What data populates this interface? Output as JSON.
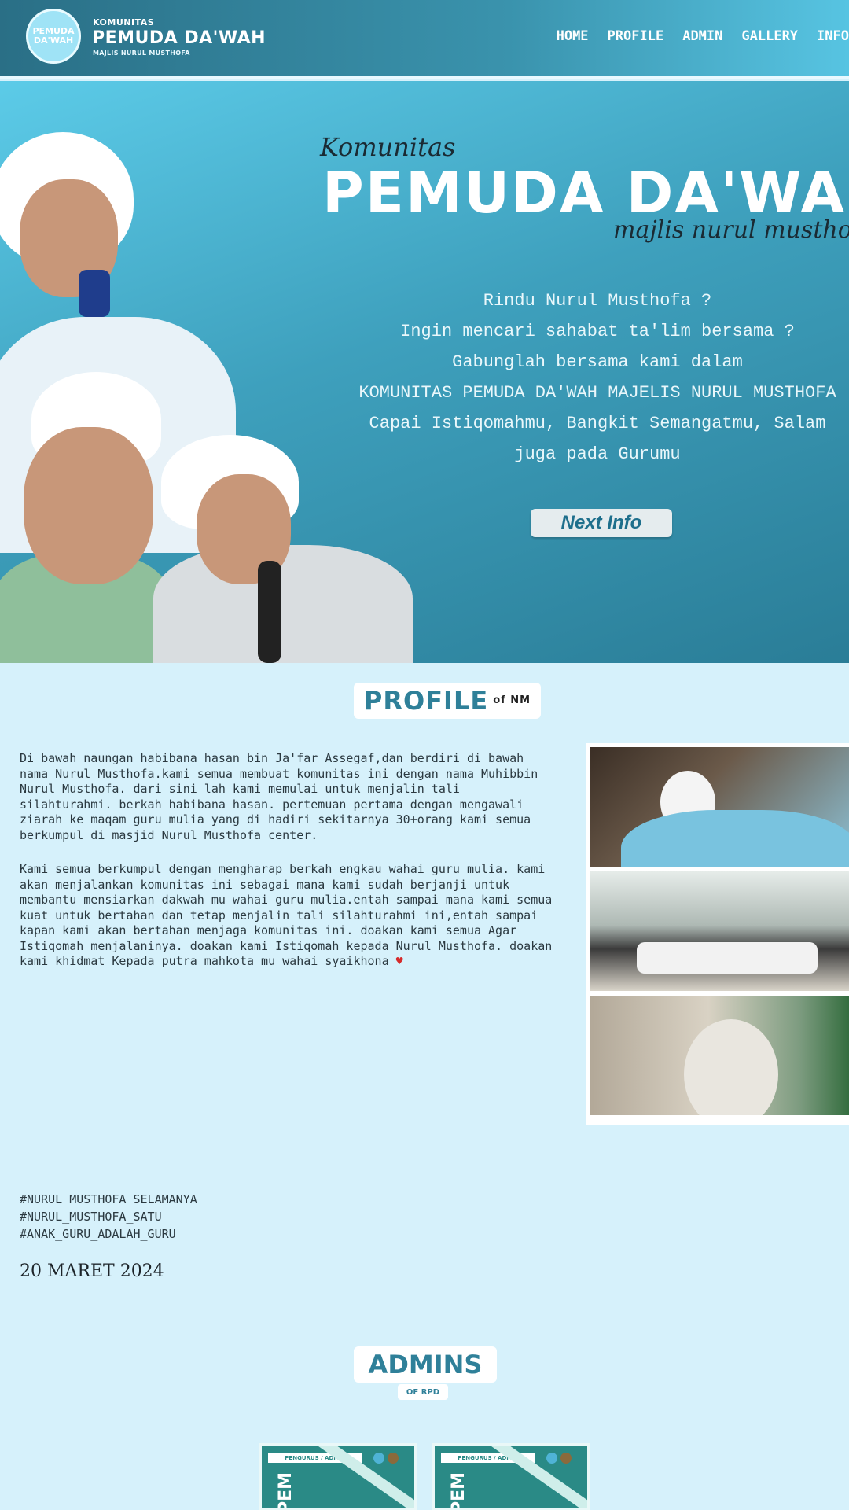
{
  "header": {
    "logo_text": "PEMUDA DA'WAH",
    "brand_small": "KOMUNITAS",
    "brand_title": "PEMUDA DA'WAH",
    "brand_sub": "MAJLIS NURUL MUSTHOFA",
    "nav": [
      "HOME",
      "PROFILE",
      "ADMIN",
      "GALLERY",
      "INFO"
    ]
  },
  "hero": {
    "komunitas": "Komunitas",
    "title": "PEMUDA DA'WAH",
    "majlis": "majlis nurul musthofa",
    "lines": [
      "Rindu Nurul Musthofa ?",
      "Ingin mencari sahabat ta'lim bersama ?",
      "Gabunglah bersama kami dalam",
      "KOMUNITAS PEMUDA DA'WAH MAJELIS NURUL MUSTHOFA",
      "Capai Istiqomahmu, Bangkit Semangatmu, Salam",
      "juga pada Gurumu"
    ],
    "next_button": "Next Info"
  },
  "profile": {
    "badge": "PROFILE",
    "badge_small": "of NM",
    "paragraph1": "Di bawah naungan habibana hasan bin Ja'far Assegaf,dan berdiri di bawah nama Nurul Musthofa.kami semua membuat komunitas ini dengan nama Muhibbin Nurul Musthofa. dari sini lah kami memulai untuk menjalin tali silahturahmi. berkah habibana hasan. pertemuan pertama dengan mengawali ziarah ke maqam guru mulia yang di hadiri sekitarnya 30+orang kami semua berkumpul di masjid Nurul Musthofa center.",
    "paragraph2": "Kami semua berkumpul dengan mengharap berkah engkau wahai guru mulia. kami akan menjalankan komunitas ini sebagai mana kami sudah berjanji untuk membantu mensiarkan dakwah mu wahai guru mulia.entah sampai mana kami semua kuat untuk bertahan dan tetap menjalin tali silahturahmi ini,entah sampai kapan kami akan bertahan menjaga komunitas ini. doakan kami semua Agar Istiqomah menjalaninya. doakan kami Istiqomah kepada Nurul Musthofa. doakan kami khidmat Kepada putra mahkota mu wahai syaikhona",
    "heart": "♥",
    "hashtags": [
      "#NURUL_MUSTHOFA_SELAMANYA",
      "#NURUL_MUSTHOFA_SATU",
      "#ANAK_GURU_ADALAH_GURU"
    ],
    "date": "20 MARET 2024"
  },
  "admins": {
    "badge": "ADMINS",
    "badge_small": "OF RPD",
    "cards": [
      {
        "head": "PENGURUS / ADMIN",
        "word": "PEM"
      },
      {
        "head": "PENGURUS / ADMIN",
        "word": "PEM"
      }
    ]
  },
  "colors": {
    "nav_bg": "#2a6f86",
    "hero_bg": "#3ea0bd",
    "page_bg": "#d6f1fb",
    "accent": "#2f8099",
    "button_text": "#1e6f8c"
  }
}
